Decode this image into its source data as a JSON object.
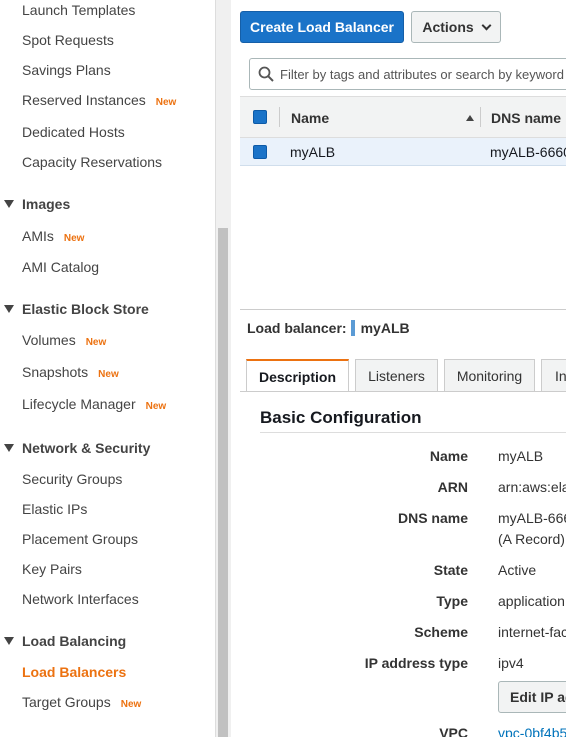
{
  "sidebar": {
    "items_top": [
      {
        "label": "Launch Templates",
        "badge": ""
      },
      {
        "label": "Spot Requests",
        "badge": ""
      },
      {
        "label": "Savings Plans",
        "badge": ""
      },
      {
        "label": "Reserved Instances",
        "badge": "New"
      },
      {
        "label": "Dedicated Hosts",
        "badge": ""
      },
      {
        "label": "Capacity Reservations",
        "badge": ""
      }
    ],
    "sections": [
      {
        "title": "Images",
        "items": [
          {
            "label": "AMIs",
            "badge": "New"
          },
          {
            "label": "AMI Catalog",
            "badge": ""
          }
        ]
      },
      {
        "title": "Elastic Block Store",
        "items": [
          {
            "label": "Volumes",
            "badge": "New"
          },
          {
            "label": "Snapshots",
            "badge": "New"
          },
          {
            "label": "Lifecycle Manager",
            "badge": "New"
          }
        ]
      },
      {
        "title": "Network & Security",
        "items": [
          {
            "label": "Security Groups",
            "badge": ""
          },
          {
            "label": "Elastic IPs",
            "badge": ""
          },
          {
            "label": "Placement Groups",
            "badge": ""
          },
          {
            "label": "Key Pairs",
            "badge": ""
          },
          {
            "label": "Network Interfaces",
            "badge": ""
          }
        ]
      },
      {
        "title": "Load Balancing",
        "items": [
          {
            "label": "Load Balancers",
            "badge": ""
          },
          {
            "label": "Target Groups",
            "badge": "New"
          }
        ]
      }
    ]
  },
  "toolbar": {
    "create_label": "Create Load Balancer",
    "actions_label": "Actions"
  },
  "search": {
    "placeholder": "Filter by tags and attributes or search by keyword"
  },
  "table": {
    "headers": [
      "Name",
      "DNS name"
    ],
    "rows": [
      {
        "name": "myALB",
        "dns": "myALB-6660"
      }
    ]
  },
  "details": {
    "lb_label": "Load balancer:",
    "lb_name": "myALB",
    "tabs": [
      "Description",
      "Listeners",
      "Monitoring",
      "In"
    ],
    "section_title": "Basic Configuration",
    "fields": [
      {
        "key": "Name",
        "value": "myALB"
      },
      {
        "key": "ARN",
        "value": "arn:aws:ela"
      },
      {
        "key": "DNS name",
        "value": "myALB-666",
        "value2": "(A Record)"
      },
      {
        "key": "State",
        "value": "Active"
      },
      {
        "key": "Type",
        "value": "application"
      },
      {
        "key": "Scheme",
        "value": "internet-fac"
      },
      {
        "key": "IP address type",
        "value": "ipv4"
      }
    ],
    "edit_ip_label": "Edit IP ad",
    "vpc": {
      "key": "VPC",
      "value": "vpc-0bf4b5"
    }
  },
  "colors": {
    "accent": "#ec7211",
    "primary": "#1a73c8",
    "link": "#0073bb"
  }
}
